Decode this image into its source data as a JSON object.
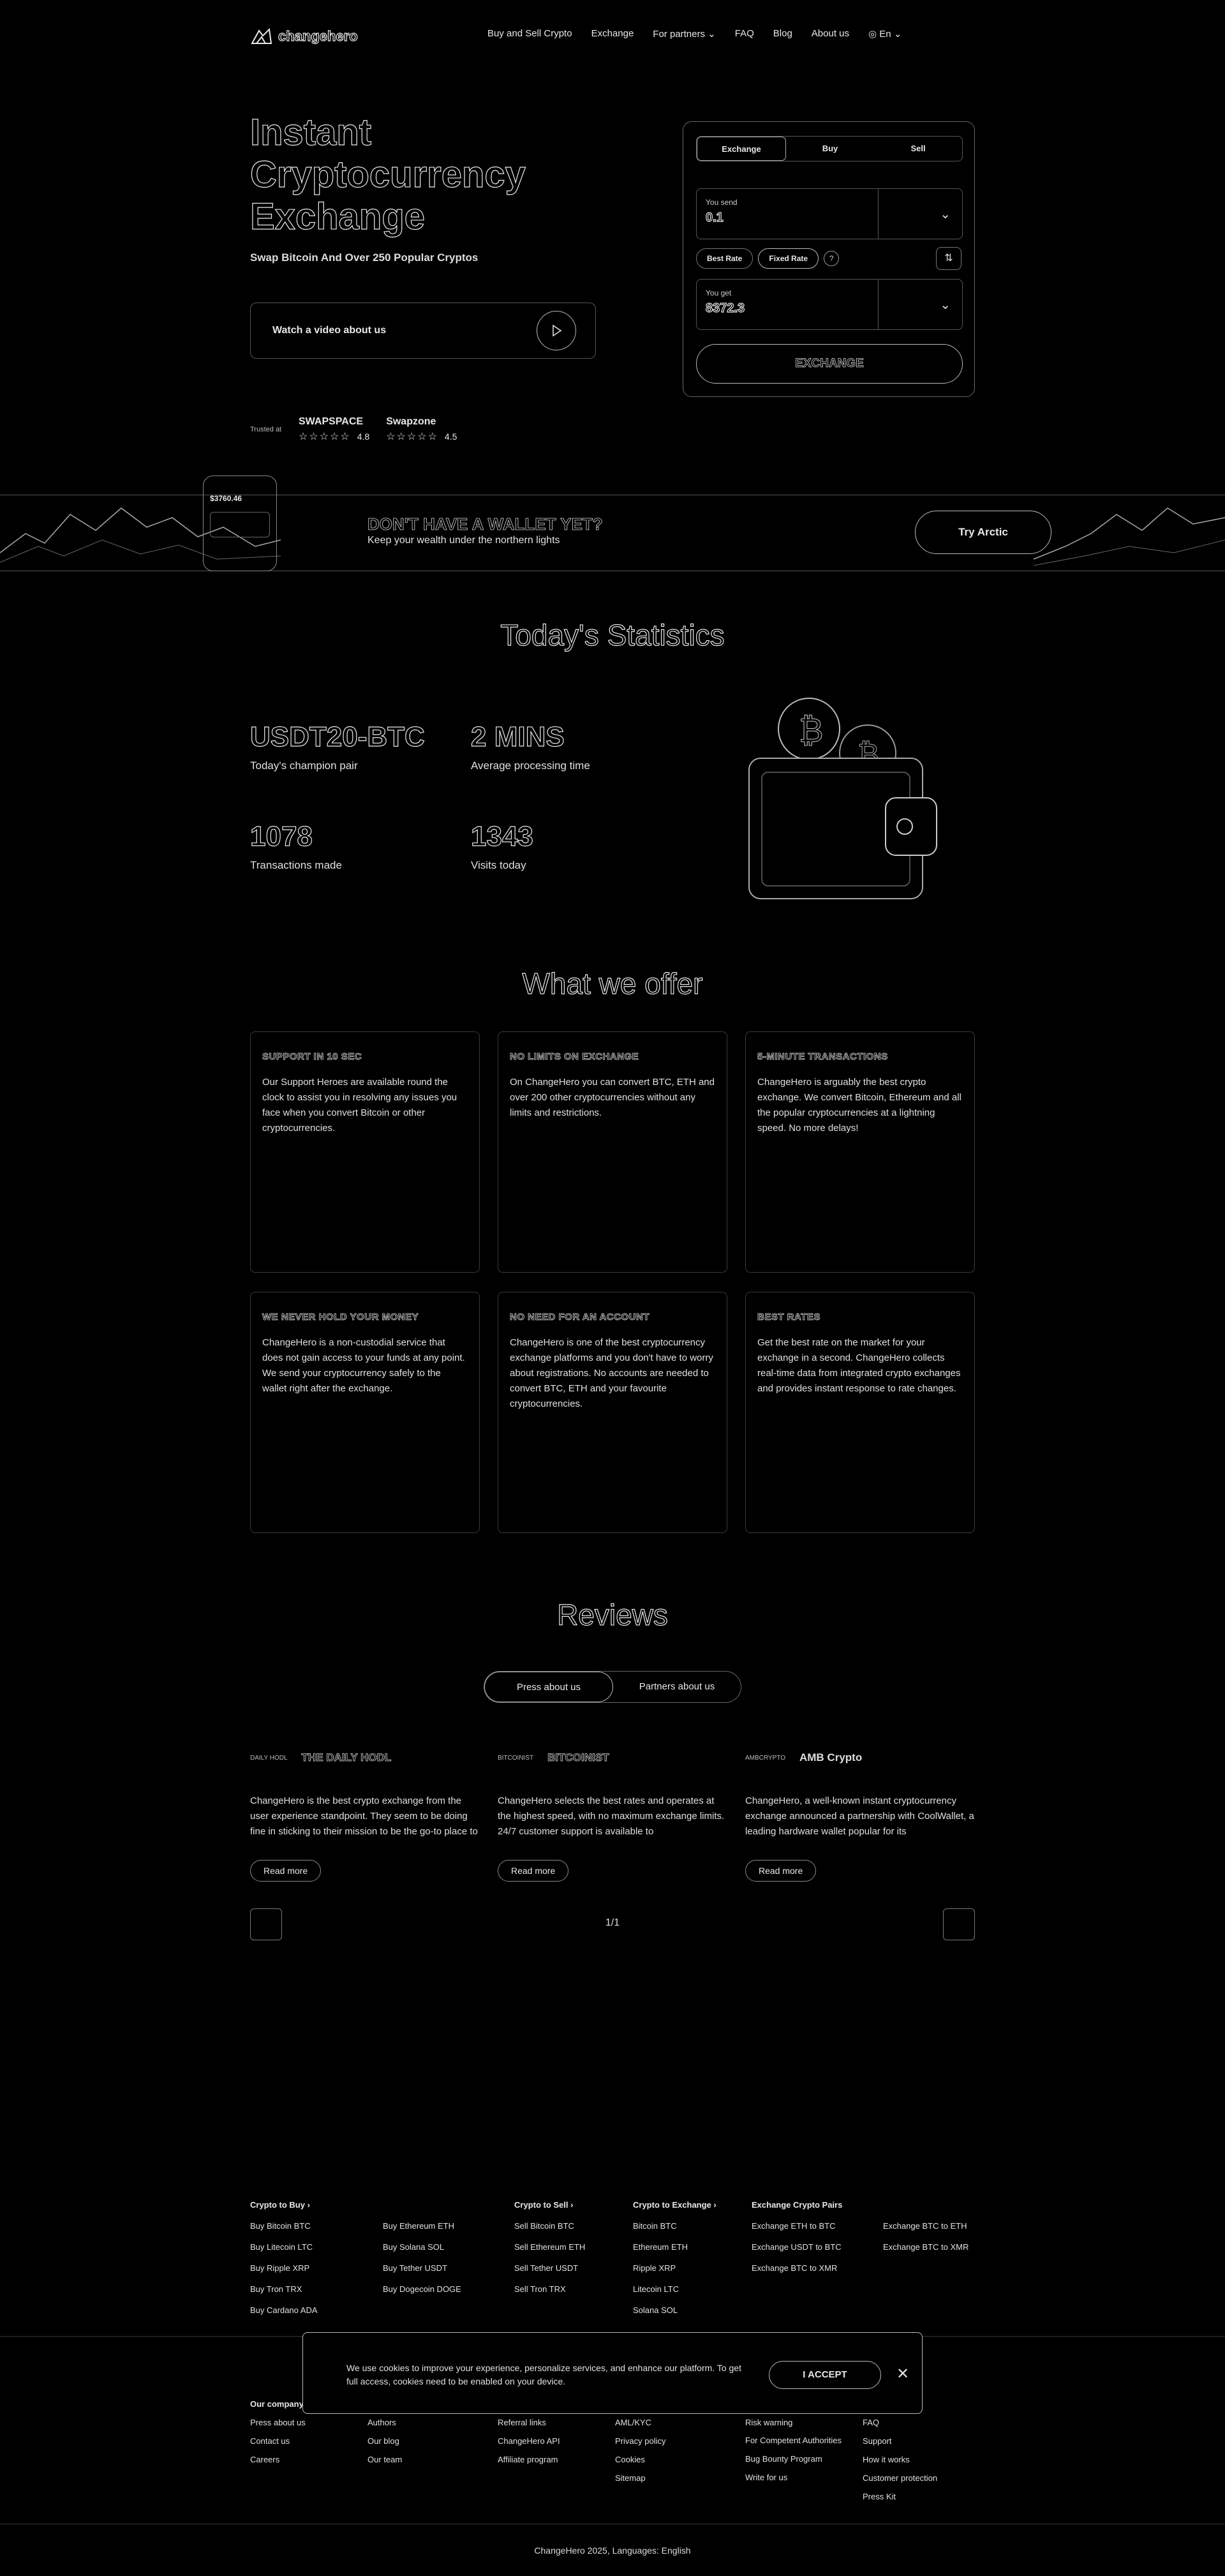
{
  "header": {
    "logo_text": "changehero",
    "nav": [
      "Buy and Sell Crypto",
      "Exchange",
      "For partners",
      "FAQ",
      "Blog",
      "About us"
    ],
    "lang": "En"
  },
  "hero": {
    "title": "Instant Cryptocurrency Exchange",
    "subtitle": "Swap Bitcoin And Over 250 Popular Cryptos",
    "video_label": "Watch a video about us",
    "trust_text": "Trusted at",
    "ratings": [
      {
        "name": "SWAPSPACE",
        "score": "4.8"
      },
      {
        "name": "Swapzone",
        "score": "4.5"
      }
    ]
  },
  "exchange": {
    "tabs": [
      "Exchange",
      "Buy",
      "Sell"
    ],
    "active_tab": "Exchange",
    "send_label": "You send",
    "send_value": "0.1",
    "rate_options": [
      "Best Rate",
      "Fixed Rate"
    ],
    "get_label": "You get",
    "get_value": "8372.3",
    "button": "EXCHANGE"
  },
  "banner": {
    "title": "DON'T HAVE A WALLET YET?",
    "subtitle": "Keep your wealth under the northern lights",
    "button": "Try Arctic",
    "phone_balance": "$3760.46"
  },
  "stats": {
    "title": "Today's Statistics",
    "items": [
      {
        "value": "USDT20-BTC",
        "label": "Today's champion pair"
      },
      {
        "value": "2 MINS",
        "label": "Average processing time"
      },
      {
        "value": "1078",
        "label": "Transactions made"
      },
      {
        "value": "1343",
        "label": "Visits today"
      }
    ]
  },
  "offers": {
    "title": "What we offer",
    "cards": [
      {
        "title": "SUPPORT IN 10 SEC",
        "text": "Our Support Heroes are available round the clock to assist you in resolving any issues you face when you convert Bitcoin or other cryptocurrencies."
      },
      {
        "title": "NO LIMITS ON EXCHANGE",
        "text": "On ChangeHero you can convert BTC, ETH and over 200 other cryptocurrencies without any limits and restrictions."
      },
      {
        "title": "5-MINUTE TRANSACTIONS",
        "text": "ChangeHero is arguably the best crypto exchange. We convert Bitcoin, Ethereum and all the popular cryptocurrencies at a lightning speed. No more delays!"
      },
      {
        "title": "WE NEVER HOLD YOUR MONEY",
        "text": "ChangeHero is a non-custodial service that does not gain access to your funds at any point. We send your cryptocurrency safely to the wallet right after the exchange."
      },
      {
        "title": "NO NEED FOR AN ACCOUNT",
        "text": "ChangeHero is one of the best cryptocurrency exchange platforms and you don't have to worry about registrations. No accounts are needed to convert BTC, ETH and your favourite cryptocurrencies."
      },
      {
        "title": "BEST RATES",
        "text": "Get the best rate on the market for your exchange in a second. ChangeHero collects real-time data from integrated crypto exchanges and provides instant response to rate changes."
      }
    ]
  },
  "reviews": {
    "title": "Reviews",
    "tabs": [
      "Press about us",
      "Partners about us"
    ],
    "active_tab": "Press about us",
    "items": [
      {
        "mini": "DAILY HODL",
        "source": "THE DAILY HODL",
        "text": "ChangeHero is the best crypto exchange from the user experience standpoint. They seem to be doing fine in sticking to their mission to be the go-to place to"
      },
      {
        "mini": "BITCOINIST",
        "source": "BITCOINIST",
        "text": "ChangeHero selects the best rates and operates at the highest speed, with no maximum exchange limits. 24/7 customer support is available to"
      },
      {
        "mini": "AMBCRYPTO",
        "source": "AMB Crypto",
        "text": "ChangeHero, a well-known instant cryptocurrency exchange announced a partnership with CoolWallet, a leading hardware wallet popular for its"
      }
    ],
    "read_more": "Read more",
    "pager": "1/1"
  },
  "footer": {
    "columns": [
      {
        "title": "Crypto to Buy",
        "items": [
          "Buy Bitcoin BTC",
          "Buy Litecoin LTC",
          "Buy Ripple XRP",
          "Buy Tron TRX",
          "Buy Cardano ADA"
        ]
      },
      {
        "title": "",
        "items": [
          "Buy Ethereum ETH",
          "Buy Solana SOL",
          "Buy Tether USDT",
          "Buy Dogecoin DOGE"
        ]
      },
      {
        "title": "Crypto to Sell",
        "items": [
          "Sell Bitcoin BTC",
          "Sell Ethereum ETH",
          "Sell Tether USDT",
          "Sell Tron TRX"
        ]
      },
      {
        "title": "Crypto to Exchange",
        "items": [
          "Bitcoin BTC",
          "Ethereum ETH",
          "Ripple XRP",
          "Litecoin LTC",
          "Solana SOL"
        ]
      },
      {
        "title": "Exchange Crypto Pairs",
        "items": [
          "Exchange ETH to BTC",
          "Exchange USDT to BTC",
          "Exchange BTC to XMR"
        ]
      },
      {
        "title": "",
        "items": [
          "Exchange BTC to ETH",
          "Exchange BTC to XMR"
        ]
      }
    ],
    "bottom_columns": [
      {
        "title": "Our company",
        "items": [
          "Press about us",
          "Contact us",
          "Careers"
        ]
      },
      {
        "title": "",
        "items": [
          "Authors",
          "Our blog",
          "Our team"
        ]
      },
      {
        "title": "",
        "items": [
          "Referral links",
          "ChangeHero API",
          "Affiliate program"
        ]
      },
      {
        "title": "",
        "items": [
          "AML/KYC",
          "Privacy policy",
          "Cookies",
          "Sitemap"
        ]
      },
      {
        "title": "",
        "items": [
          "Risk warning",
          "For Competent Authorities",
          "Bug Bounty Program",
          "Write for us"
        ]
      },
      {
        "title": "",
        "items": [
          "FAQ",
          "Support",
          "How it works",
          "Customer protection",
          "Press Kit"
        ]
      }
    ],
    "copyright": "ChangeHero 2025, Languages: English"
  },
  "cookie": {
    "text": "We use cookies to improve your experience, personalize services, and enhance our platform. To get full access, cookies need to be enabled on your device.",
    "button": "I ACCEPT"
  }
}
